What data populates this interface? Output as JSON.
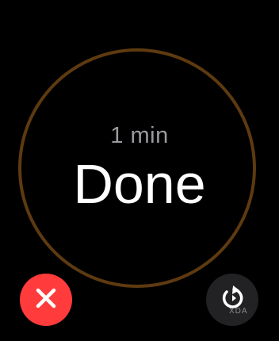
{
  "timer": {
    "duration_label": "1 min",
    "status_label": "Done",
    "ring_color": "#5e3a10"
  },
  "controls": {
    "cancel": {
      "icon": "x-icon",
      "color": "#ff3b3b"
    },
    "restart": {
      "icon": "restart-icon",
      "color": "#222225"
    }
  },
  "watermark": {
    "text": "XDA"
  }
}
